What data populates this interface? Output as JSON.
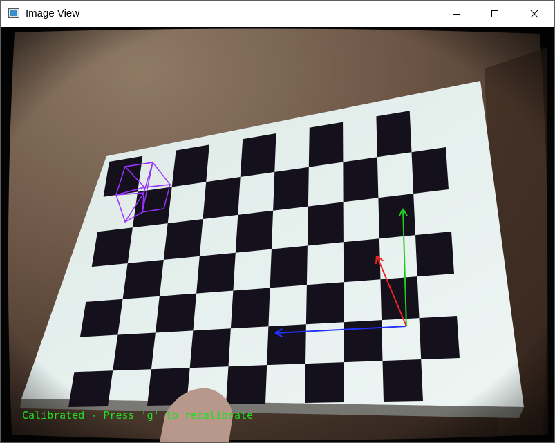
{
  "window": {
    "title": "Image View",
    "controls": {
      "minimize": "minimize-icon",
      "maximize": "maximize-icon",
      "close": "close-icon"
    }
  },
  "view": {
    "status_text": "Calibrated - Press 'g' to recalibrate",
    "status_color": "#22dd22",
    "axis_colors": {
      "x": "#2233ff",
      "y": "#22cc22",
      "z": "#ee2222"
    },
    "cube_color": "#9933ff",
    "board": {
      "rows": 7,
      "cols": 10,
      "square_color": "#14101c",
      "paper_color": "#e4f1ee"
    }
  }
}
